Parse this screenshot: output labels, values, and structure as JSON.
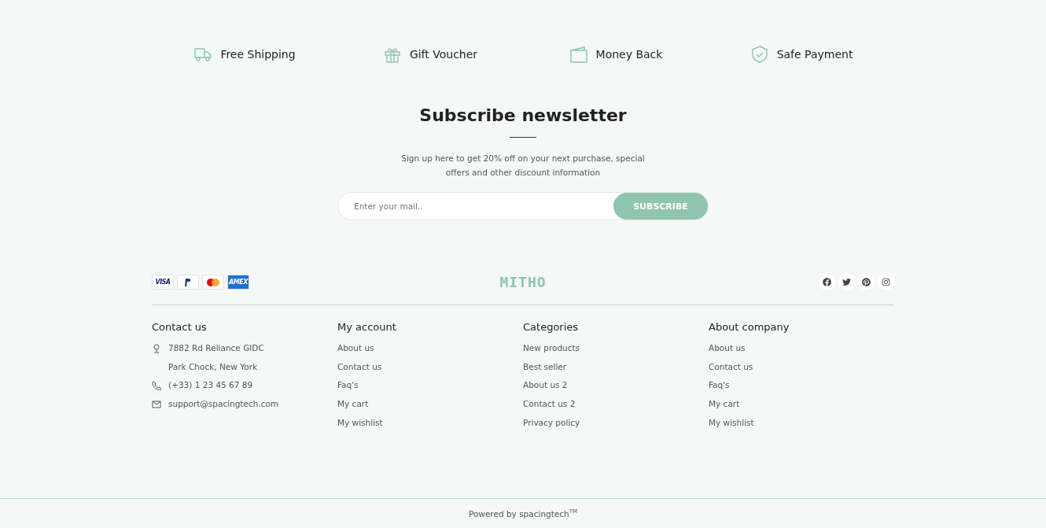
{
  "features": [
    {
      "kind": "truck",
      "label": "Free Shipping"
    },
    {
      "kind": "gift",
      "label": "Gift Voucher"
    },
    {
      "kind": "wallet",
      "label": "Money Back"
    },
    {
      "kind": "shield",
      "label": "Safe Payment"
    }
  ],
  "newsletter": {
    "title": "Subscribe newsletter",
    "text": "Sign up here to get 20% off on your next purchase, special offers and other discount information",
    "placeholder": "Enter your mail..",
    "button": "SUBSCRIBE"
  },
  "payment_cards": [
    {
      "kind": "visa",
      "label": "VISA"
    },
    {
      "kind": "paypal"
    },
    {
      "kind": "mastercard"
    },
    {
      "kind": "amex",
      "label": "AMEX"
    }
  ],
  "logo": "MITHO",
  "social": [
    {
      "kind": "facebook"
    },
    {
      "kind": "twitter"
    },
    {
      "kind": "pinterest"
    },
    {
      "kind": "instagram"
    }
  ],
  "contact": {
    "title": "Contact us",
    "items": [
      {
        "kind": "address",
        "lines": [
          "7882 Rd Reliance GIDC",
          "Park Chock, New York"
        ]
      },
      {
        "kind": "phone",
        "lines": [
          "(+33) 1 23 45 67 89"
        ]
      },
      {
        "kind": "email",
        "lines": [
          "support@spacingtech.com"
        ]
      }
    ]
  },
  "link_columns": [
    {
      "title": "My account",
      "links": [
        "About us",
        "Contact us",
        "Faq's",
        "My cart",
        "My wishlist"
      ]
    },
    {
      "title": "Categories",
      "links": [
        "New products",
        "Best seller",
        "About us 2",
        "Contact us 2",
        "Privacy policy"
      ]
    },
    {
      "title": "About company",
      "links": [
        "About us",
        "Contact us",
        "Faq's",
        "My cart",
        "My wishlist"
      ]
    }
  ],
  "copyright": "Powered by spacingtech$^{TM}$"
}
